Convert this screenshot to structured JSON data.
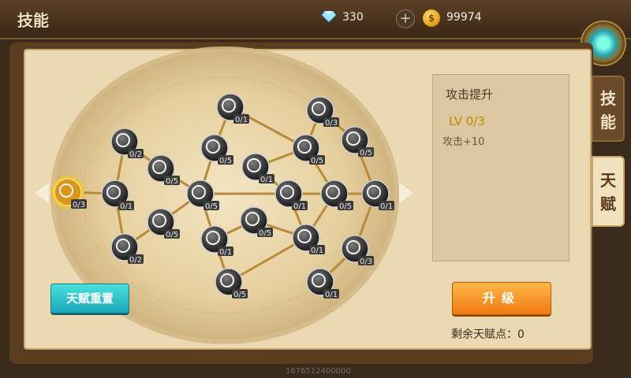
{
  "header": {
    "title": "技能",
    "gems": "330",
    "gold": "99974"
  },
  "tabs": [
    {
      "label": "技\n能",
      "active": false
    },
    {
      "label": "天\n赋",
      "active": true
    }
  ],
  "info": {
    "title": "攻击提升",
    "level": "LV 0/3",
    "desc": "攻击+10"
  },
  "buttons": {
    "reset": "天赋重置",
    "upgrade": "升级"
  },
  "points_label": "剩余天赋点：0",
  "bottom_text": "1676512400000",
  "nodes": [
    {
      "icon": "feather-icon",
      "level": "0/3",
      "selected": true
    },
    {
      "icon": "winged-boot-icon",
      "level": "0/2",
      "selected": false
    },
    {
      "icon": "wings-icon",
      "level": "0/1",
      "selected": false
    },
    {
      "icon": "exp-icon",
      "level": "0/5",
      "selected": false
    },
    {
      "icon": "potion-icon",
      "level": "0/5",
      "selected": false
    },
    {
      "icon": "cross-shield-icon",
      "level": "0/2",
      "selected": false
    },
    {
      "icon": "sword-figure-icon",
      "level": "0/1",
      "selected": false
    },
    {
      "icon": "armor-icon",
      "level": "0/5",
      "selected": false
    },
    {
      "icon": "slash-icon",
      "level": "0/5",
      "selected": false
    },
    {
      "icon": "flexed-arm-icon",
      "level": "0/1",
      "selected": false
    },
    {
      "icon": "target-icon",
      "level": "0/5",
      "selected": false
    },
    {
      "icon": "gauntlet-icon",
      "level": "0/5",
      "selected": false
    },
    {
      "icon": "shield-star-icon",
      "level": "0/1",
      "selected": false
    },
    {
      "icon": "tower-shield-icon",
      "level": "0/1",
      "selected": false
    },
    {
      "icon": "flame-claw-icon",
      "level": "0/5",
      "selected": false
    },
    {
      "icon": "hex-shield-icon",
      "level": "0/3",
      "selected": false
    },
    {
      "icon": "dagger-icon",
      "level": "0/1",
      "selected": false
    },
    {
      "icon": "heart-icon",
      "level": "0/5",
      "selected": false
    },
    {
      "icon": "vortex-icon",
      "level": "0/1",
      "selected": false
    },
    {
      "icon": "helmet-icon",
      "level": "0/5",
      "selected": false
    },
    {
      "icon": "gear-icon",
      "level": "0/3",
      "selected": false
    },
    {
      "icon": "spiral-icon",
      "level": "0/1",
      "selected": false
    }
  ],
  "colors": {
    "reset_button": "#1aa8b8",
    "upgrade_button": "#f07a10",
    "level_text": "#b68a00"
  }
}
